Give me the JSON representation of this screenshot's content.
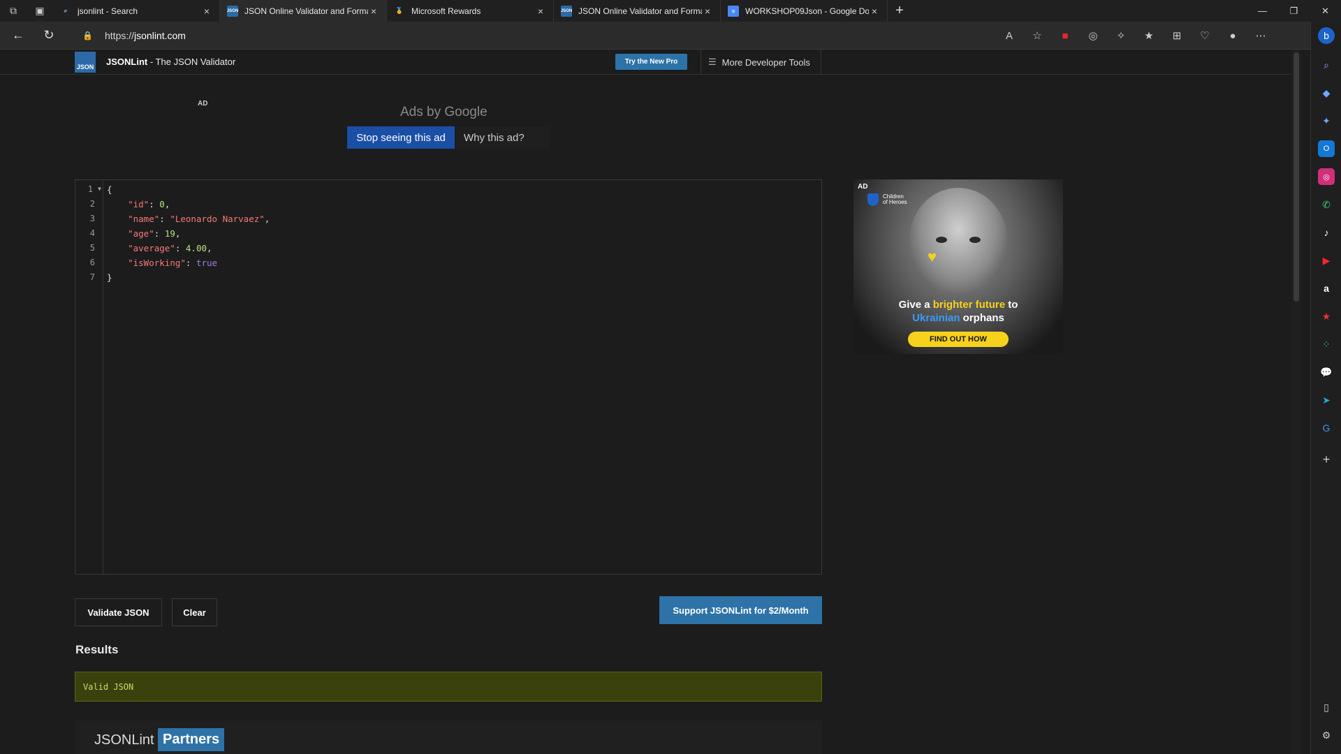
{
  "tabs": [
    {
      "title": "jsonlint - Search",
      "active": false
    },
    {
      "title": "JSON Online Validator and Formatter - JSON Lint",
      "active": true
    },
    {
      "title": "Microsoft Rewards",
      "active": false
    },
    {
      "title": "JSON Online Validator and Formatter - JSON Lint",
      "active": false
    },
    {
      "title": "WORKSHOP09Json - Google Docs",
      "active": false
    }
  ],
  "address": {
    "protocol": "https://",
    "host": "jsonlint.com"
  },
  "site": {
    "brand": "JSONLint",
    "tagline": " - The JSON Validator",
    "logo_text": "JSON",
    "try_pro": "Try the New Pro",
    "more_tools": "More Developer Tools"
  },
  "top_ad": {
    "label": "AD",
    "ads_by": "Ads by Google",
    "stop": "Stop seeing this ad",
    "why": "Why this ad?"
  },
  "editor": {
    "line_numbers": [
      "1",
      "2",
      "3",
      "4",
      "5",
      "6",
      "7"
    ],
    "lines": {
      "l1": "{",
      "l2_key": "\"id\"",
      "l2_val": "0",
      "l3_key": "\"name\"",
      "l3_val": "\"Leonardo Narvaez\"",
      "l4_key": "\"age\"",
      "l4_val": "19",
      "l5_key": "\"average\"",
      "l5_val": "4.00",
      "l6_key": "\"isWorking\"",
      "l6_val": "true",
      "l7": "}"
    }
  },
  "side_ad": {
    "label": "AD",
    "org_line1": "Children",
    "org_line2": "of Heroes",
    "text_1": "Give a ",
    "text_2": "brighter future",
    "text_3": " to",
    "text_4": "Ukrainian",
    "text_5": " orphans",
    "cta": "FIND OUT HOW"
  },
  "actions": {
    "validate": "Validate JSON",
    "clear": "Clear",
    "support": "Support JSONLint for $2/Month"
  },
  "results": {
    "title": "Results",
    "message": "Valid JSON"
  },
  "partners": {
    "label": "JSONLint",
    "highlight": "Partners"
  },
  "colors": {
    "accent": "#2d73a8",
    "ad_button": "#1a4fa5",
    "valid_bg": "#3b410c",
    "valid_text": "#c8dd68"
  }
}
